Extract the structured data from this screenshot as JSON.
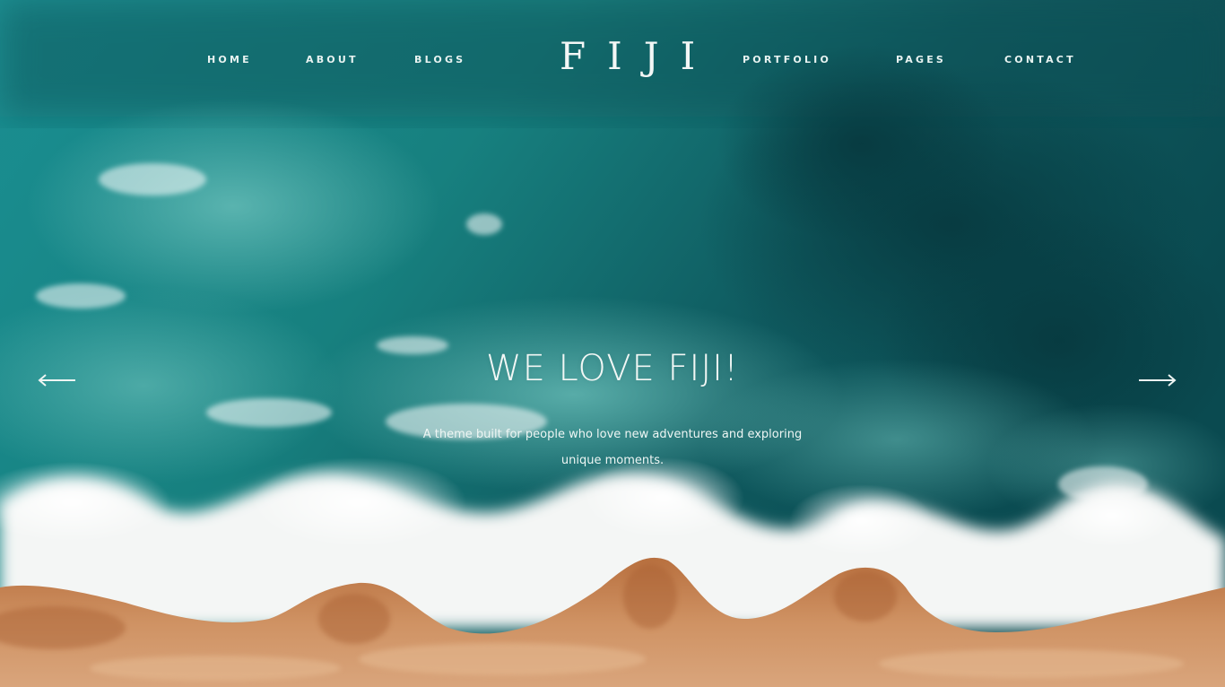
{
  "nav": {
    "items_left": [
      "HOME",
      "ABOUT",
      "BLOGS"
    ],
    "logo": "FIJI",
    "items_right": [
      "PORTFOLIO",
      "PAGES",
      "CONTACT"
    ]
  },
  "hero": {
    "headline": "WE LOVE FIJI!",
    "subtitle": "A theme built for people who love new adventures and exploring unique moments.",
    "prev_icon": "arrow-left-icon",
    "next_icon": "arrow-right-icon"
  },
  "colors": {
    "ocean_dark": "#0e4f55",
    "ocean_mid": "#1b8a8c",
    "foam": "#f2f5f3",
    "sand": "#c98a5a",
    "text": "#f2f7f5"
  }
}
